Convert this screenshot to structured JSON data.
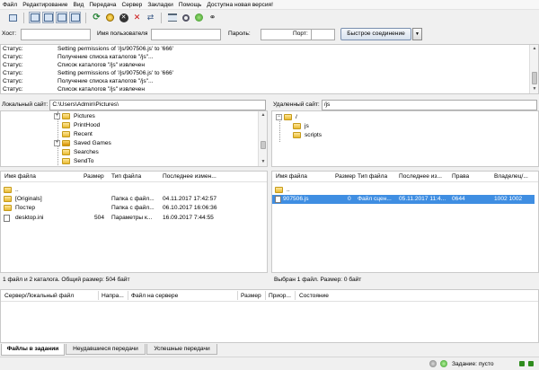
{
  "menu": [
    "Файл",
    "Редактирование",
    "Вид",
    "Передача",
    "Сервер",
    "Закладки",
    "Помощь",
    "Доступна новая версия!"
  ],
  "toolbar": {
    "icons": [
      "site-manager",
      "toggle-log",
      "toggle-local-tree",
      "toggle-remote-tree",
      "toggle-queue",
      "refresh",
      "process-queue",
      "cancel",
      "disconnect",
      "reconnect",
      "filter",
      "compare",
      "sync-browse",
      "find"
    ]
  },
  "quickconnect": {
    "host_label": "Хост:",
    "host_value": "",
    "user_label": "Имя пользователя",
    "user_value": "",
    "pass_label": "Пароль:",
    "pass_value": "",
    "port_label": "Порт:",
    "port_value": "",
    "connect_button": "Быстрое соединение",
    "dropdown_arrow": "▼"
  },
  "log": [
    {
      "type": "Статус:",
      "msg": "Setting permissions of '/js/907506.js' to '666'"
    },
    {
      "type": "Статус:",
      "msg": "Получение списка каталогов \"/js\"..."
    },
    {
      "type": "Статус:",
      "msg": "Список каталогов \"/js\" извлечен"
    },
    {
      "type": "Статус:",
      "msg": "Setting permissions of '/js/907506.js' to '666'"
    },
    {
      "type": "Статус:",
      "msg": "Получение списка каталогов \"/js\"..."
    },
    {
      "type": "Статус:",
      "msg": "Список каталогов \"/js\" извлечен"
    }
  ],
  "local": {
    "path_label": "Локальный сайт:",
    "path_value": "C:\\Users\\Admin\\Pictures\\",
    "tree": [
      {
        "label": "Pictures",
        "expander": "+"
      },
      {
        "label": "PrintHood",
        "expander": ""
      },
      {
        "label": "Recent",
        "expander": ""
      },
      {
        "label": "Saved Games",
        "expander": "+"
      },
      {
        "label": "Searches",
        "expander": ""
      },
      {
        "label": "SendTo",
        "expander": ""
      }
    ],
    "columns": [
      "Имя файла",
      "Размер",
      "Тип файла",
      "Последнее измен..."
    ],
    "files": [
      {
        "name": "..",
        "size": "",
        "type": "",
        "modified": ""
      },
      {
        "name": "[Originals]",
        "size": "",
        "type": "Папка с файл...",
        "modified": "04.11.2017 17:42:57"
      },
      {
        "name": "Постер",
        "size": "",
        "type": "Папка с файл...",
        "modified": "06.10.2017 16:06:36"
      },
      {
        "name": "desktop.ini",
        "size": "504",
        "type": "Параметры к...",
        "modified": "16.09.2017 7:44:55"
      }
    ],
    "status": "1 файл и 2 каталога. Общий размер: 504 байт"
  },
  "remote": {
    "path_label": "Удаленный сайт:",
    "path_value": "/js",
    "tree": [
      {
        "label": "/",
        "expander": "−"
      },
      {
        "label": "js",
        "expander": ""
      },
      {
        "label": "scripts",
        "expander": ""
      }
    ],
    "columns": [
      "Имя файла",
      "Размер",
      "Тип файла",
      "Последнее из...",
      "Права",
      "Владелец/..."
    ],
    "files": [
      {
        "name": "..",
        "size": "",
        "type": "",
        "modified": "",
        "perms": "",
        "owner": ""
      },
      {
        "name": "907506.js",
        "size": "0",
        "type": "Файл сцен...",
        "modified": "05.11.2017 11:4...",
        "perms": "0644",
        "owner": "1002 1002"
      }
    ],
    "status": "Выбран 1 файл. Размер: 0 байт"
  },
  "queue": {
    "columns": [
      "Сервер/Локальный файл",
      "Напра...",
      "Файл на сервере",
      "Размер",
      "Приор...",
      "Состояние"
    ]
  },
  "tabs": [
    "Файлы в задании",
    "Неудавшиеся передачи",
    "Успешные передачи"
  ],
  "statusbar": {
    "queue_text": "Задание: пусто"
  }
}
